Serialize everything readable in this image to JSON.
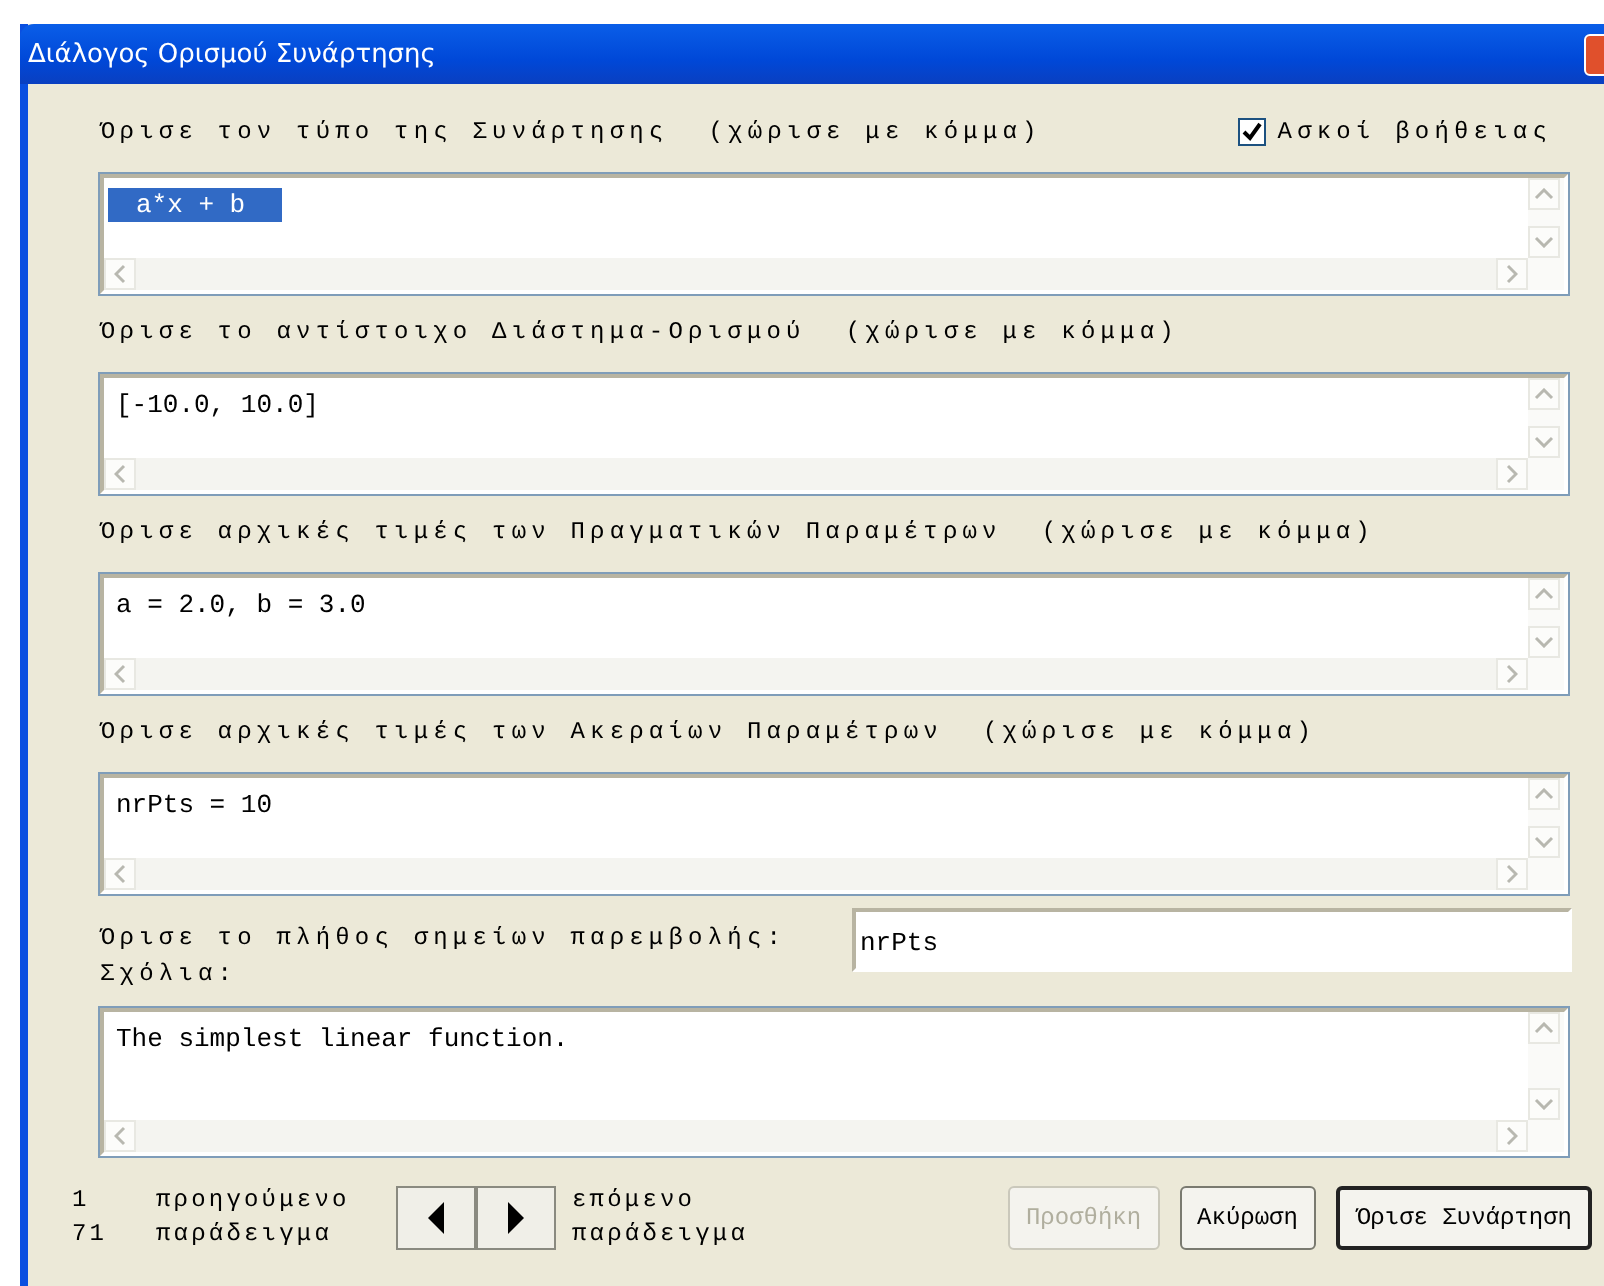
{
  "window": {
    "title": "Διάλογος Ορισμού Συνάρτησης"
  },
  "help_checkbox": {
    "label": "Ασκοί βοήθειας",
    "checked": true
  },
  "fields": [
    {
      "label": "Όρισε τον τύπο της Συνάρτησης",
      "hint": "(χώρισε με κόμμα)",
      "value": "a*x + b",
      "selected": true
    },
    {
      "label": "Όρισε το αντίστοιχο Διάστημα-Ορισμού",
      "hint": "(χώρισε με κόμμα)",
      "value": "[-10.0, 10.0]",
      "selected": false
    },
    {
      "label": "Όρισε αρχικές τιμές των Πραγματικών Παραμέτρων",
      "hint": "(χώρισε με κόμμα)",
      "value": "a = 2.0, b = 3.0",
      "selected": false
    },
    {
      "label": "Όρισε αρχικές τιμές των Ακεραίων Παραμέτρων",
      "hint": "(χώρισε με κόμμα)",
      "value": "nrPts = 10",
      "selected": false
    }
  ],
  "interpolation": {
    "label": "Όρισε το πλήθος σημείων παρεμβολής:",
    "value": "nrPts"
  },
  "comments": {
    "label": "Σχόλια:",
    "value": "The simplest linear function."
  },
  "footer": {
    "counter": [
      "1",
      "71"
    ],
    "previous": [
      "προηγούμενο",
      "παράδειγμα"
    ],
    "next": [
      "επόμενο",
      "παράδειγμα"
    ]
  },
  "buttons": [
    {
      "label": "Προσθήκη",
      "disabled": true,
      "default": false
    },
    {
      "label": "Ακύρωση",
      "disabled": false,
      "default": false
    },
    {
      "label": "Όρισε Συνάρτηση",
      "disabled": false,
      "default": true
    }
  ]
}
